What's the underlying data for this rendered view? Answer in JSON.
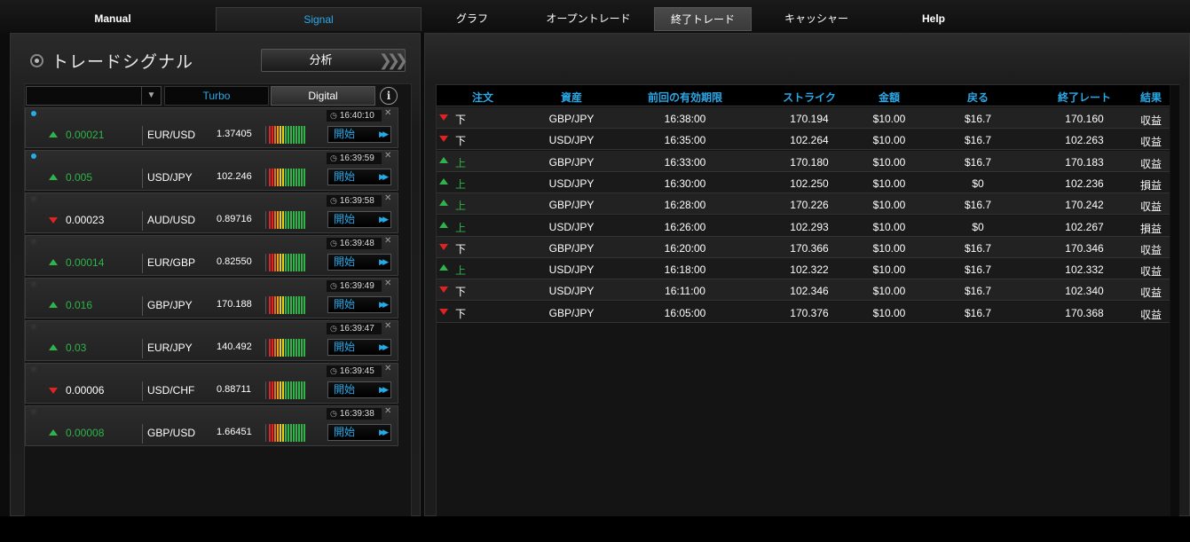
{
  "nav": {
    "items": [
      "Manual",
      "Signal",
      "グラフ",
      "オープントレード",
      "終了トレード",
      "キャッシャー",
      "Help"
    ]
  },
  "signals_panel": {
    "title": "トレードシグナル",
    "analyze_label": "分析",
    "tabs": {
      "turbo": "Turbo",
      "digital": "Digital"
    },
    "info_glyph": "i",
    "start_label": "開始",
    "items": [
      {
        "time": "16:40:10",
        "direction": "up",
        "change": "0.00021",
        "pair": "EUR/USD",
        "rate": "1.37405",
        "active": true
      },
      {
        "time": "16:39:59",
        "direction": "up",
        "change": "0.005",
        "pair": "USD/JPY",
        "rate": "102.246",
        "active": true
      },
      {
        "time": "16:39:58",
        "direction": "down",
        "change": "0.00023",
        "pair": "AUD/USD",
        "rate": "0.89716",
        "active": false
      },
      {
        "time": "16:39:48",
        "direction": "up",
        "change": "0.00014",
        "pair": "EUR/GBP",
        "rate": "0.82550",
        "active": false
      },
      {
        "time": "16:39:49",
        "direction": "up",
        "change": "0.016",
        "pair": "GBP/JPY",
        "rate": "170.188",
        "active": false
      },
      {
        "time": "16:39:47",
        "direction": "up",
        "change": "0.03",
        "pair": "EUR/JPY",
        "rate": "140.492",
        "active": false
      },
      {
        "time": "16:39:45",
        "direction": "down",
        "change": "0.00006",
        "pair": "USD/CHF",
        "rate": "0.88711",
        "active": false
      },
      {
        "time": "16:39:38",
        "direction": "up",
        "change": "0.00008",
        "pair": "GBP/USD",
        "rate": "1.66451",
        "active": false
      }
    ]
  },
  "trades_panel": {
    "headers": [
      "注文",
      "資産",
      "前回の有効期限",
      "ストライク",
      "金額",
      "戻る",
      "終了レート",
      "結果"
    ],
    "rows": [
      {
        "dir": "down",
        "order": "下",
        "asset": "GBP/JPY",
        "expiry": "16:38:00",
        "strike": "170.194",
        "amount": "$10.00",
        "return": "$16.7",
        "close": "170.160",
        "result": "収益"
      },
      {
        "dir": "down",
        "order": "下",
        "asset": "USD/JPY",
        "expiry": "16:35:00",
        "strike": "102.264",
        "amount": "$10.00",
        "return": "$16.7",
        "close": "102.263",
        "result": "収益"
      },
      {
        "dir": "up",
        "order": "上",
        "asset": "GBP/JPY",
        "expiry": "16:33:00",
        "strike": "170.180",
        "amount": "$10.00",
        "return": "$16.7",
        "close": "170.183",
        "result": "収益"
      },
      {
        "dir": "up",
        "order": "上",
        "asset": "USD/JPY",
        "expiry": "16:30:00",
        "strike": "102.250",
        "amount": "$10.00",
        "return": "$0",
        "close": "102.236",
        "result": "損益"
      },
      {
        "dir": "up",
        "order": "上",
        "asset": "GBP/JPY",
        "expiry": "16:28:00",
        "strike": "170.226",
        "amount": "$10.00",
        "return": "$16.7",
        "close": "170.242",
        "result": "収益"
      },
      {
        "dir": "up",
        "order": "上",
        "asset": "USD/JPY",
        "expiry": "16:26:00",
        "strike": "102.293",
        "amount": "$10.00",
        "return": "$0",
        "close": "102.267",
        "result": "損益"
      },
      {
        "dir": "down",
        "order": "下",
        "asset": "GBP/JPY",
        "expiry": "16:20:00",
        "strike": "170.366",
        "amount": "$10.00",
        "return": "$16.7",
        "close": "170.346",
        "result": "収益"
      },
      {
        "dir": "up",
        "order": "上",
        "asset": "USD/JPY",
        "expiry": "16:18:00",
        "strike": "102.322",
        "amount": "$10.00",
        "return": "$16.7",
        "close": "102.332",
        "result": "収益"
      },
      {
        "dir": "down",
        "order": "下",
        "asset": "USD/JPY",
        "expiry": "16:11:00",
        "strike": "102.346",
        "amount": "$10.00",
        "return": "$16.7",
        "close": "102.340",
        "result": "収益"
      },
      {
        "dir": "down",
        "order": "下",
        "asset": "GBP/JPY",
        "expiry": "16:05:00",
        "strike": "170.376",
        "amount": "$10.00",
        "return": "$16.7",
        "close": "170.368",
        "result": "収益"
      }
    ]
  },
  "colors": {
    "accent": "#29a9e8",
    "up": "#2fb34a",
    "down": "#e02222",
    "meter": [
      "#e02222",
      "#e02222",
      "#e86a1a",
      "#e8a21a",
      "#e8d01a",
      "#e8d01a",
      "#2fb34a",
      "#2fb34a",
      "#2fb34a",
      "#2fb34a",
      "#2fb34a",
      "#2fb34a",
      "#2fb34a",
      "#2fb34a"
    ]
  },
  "icons": {
    "radio": "radio-icon",
    "dropdown": "chevron-down-icon",
    "info": "info-icon",
    "clock": "clock-icon",
    "close": "close-icon",
    "play": "play-icon",
    "up": "arrow-up-icon",
    "down": "arrow-down-icon"
  }
}
